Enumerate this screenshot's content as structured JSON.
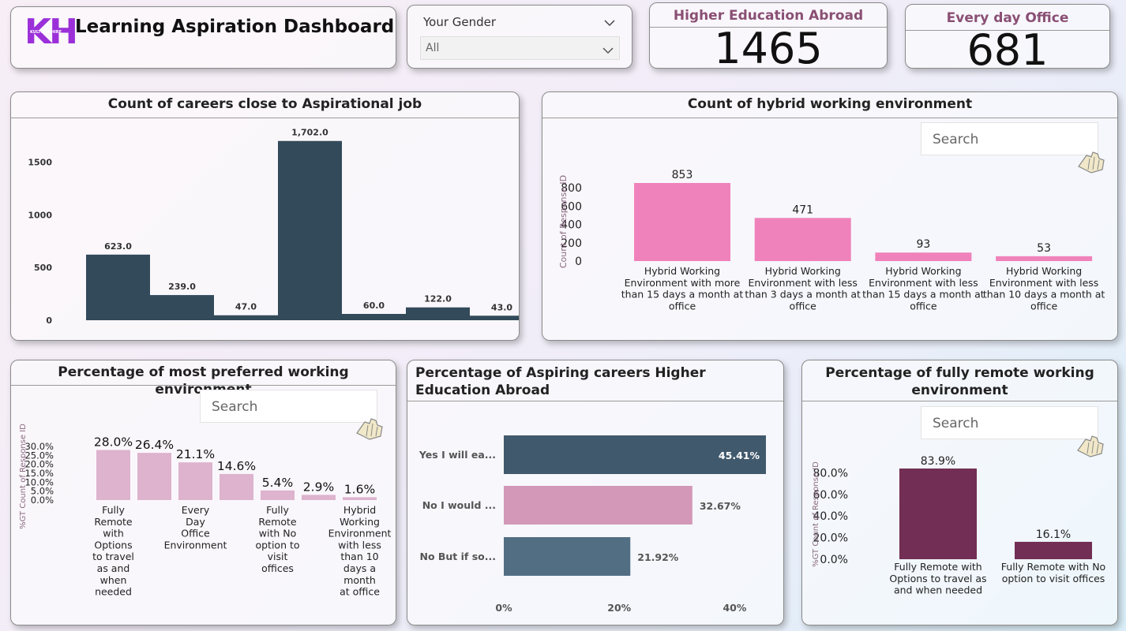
{
  "header": {
    "logo_text": "KH",
    "logo_caption": "KULTURE HIRE",
    "title": "Learning Aspiration Dashboard"
  },
  "filter": {
    "label": "Your Gender",
    "selected": "All"
  },
  "kpis": [
    {
      "label": "Higher Education Abroad",
      "value": "1465"
    },
    {
      "label": "Every day Office",
      "value": "681"
    }
  ],
  "colors": {
    "dark": "#324a5a",
    "pink": "#f082bb",
    "mauve": "#ddb3cd",
    "plum": "#722e55",
    "kpi_label": "#8a4f74",
    "logo": "#9b30d9"
  },
  "search_placeholder": "Search",
  "panels": {
    "careers": "Count of careers close to Aspirational job",
    "hybrid": "Count of hybrid working environment",
    "preferred": "Percentage of most preferred working environment",
    "abroad": "Percentage of Aspiring careers Higher Education Abroad",
    "remote": "Percentage of fully remote working environment"
  },
  "chart_data": [
    {
      "type": "bar",
      "title": "Count of careers close to Aspirational job",
      "values": [
        623.0,
        239.0,
        47.0,
        1702.0,
        60.0,
        122.0,
        43.0
      ],
      "value_labels": [
        "623.0",
        "239.0",
        "47.0",
        "1,702.0",
        "60.0",
        "122.0",
        "43.0"
      ],
      "yticks": [
        0,
        500,
        1000,
        1500
      ],
      "ylim": [
        0,
        1700
      ]
    },
    {
      "type": "bar",
      "title": "Count of hybrid working environment",
      "ylabel": "Count of Response ID",
      "categories": [
        [
          "Hybrid Working",
          "Environment with more",
          "than 15 days a month at",
          "office"
        ],
        [
          "Hybrid Working",
          "Environment with less",
          "than 3 days a month at",
          "office"
        ],
        [
          "Hybrid Working",
          "Environment with less",
          "than 15 days a month at",
          "office"
        ],
        [
          "Hybrid Working",
          "Environment with less",
          "than 10 days a month at",
          "office"
        ]
      ],
      "values": [
        853,
        471,
        93,
        53
      ],
      "yticks": [
        0,
        200,
        400,
        600,
        800
      ],
      "ylim": [
        0,
        853
      ]
    },
    {
      "type": "bar",
      "title": "Percentage of most preferred working environment",
      "ylabel": "%GT Count of Response ID",
      "categories": [
        [
          "Fully",
          "Remote",
          "with",
          "Options",
          "to travel",
          "as and",
          "when",
          "needed"
        ],
        [],
        [
          "Every",
          "Day",
          "Office",
          "Environment"
        ],
        [],
        [
          "Fully",
          "Remote",
          "with No",
          "option to",
          "visit",
          "offices"
        ],
        [],
        [
          "Hybrid",
          "Working",
          "Environment",
          "with less",
          "than 10",
          "days a",
          "month",
          "at office"
        ]
      ],
      "values": [
        28.0,
        26.4,
        21.1,
        14.6,
        5.4,
        2.9,
        1.6
      ],
      "value_labels": [
        "28.0%",
        "26.4%",
        "21.1%",
        "14.6%",
        "5.4%",
        "2.9%",
        "1.6%"
      ],
      "yticks": [
        "0.0%",
        "5.0%",
        "10.0%",
        "15.0%",
        "20.0%",
        "25.0%",
        "30.0%"
      ],
      "ylim": [
        0,
        30
      ]
    },
    {
      "type": "bar",
      "orientation": "horizontal",
      "title": "Percentage of Aspiring careers Higher Education Abroad",
      "categories": [
        "Yes I will ea...",
        "No I would ...",
        "No But if so..."
      ],
      "values": [
        45.41,
        32.67,
        21.92
      ],
      "value_labels": [
        "45.41%",
        "32.67%",
        "21.92%"
      ],
      "xticks": [
        "0%",
        "20%",
        "40%"
      ],
      "xlim": [
        0,
        45.41
      ]
    },
    {
      "type": "bar",
      "title": "Percentage of fully remote working environment",
      "ylabel": "%GT Count of Response ID",
      "categories": [
        [
          "Fully Remote with",
          "Options to travel as",
          "and when needed"
        ],
        [
          "Fully Remote with No",
          "option to visit offices"
        ]
      ],
      "values": [
        83.9,
        16.1
      ],
      "value_labels": [
        "83.9%",
        "16.1%"
      ],
      "yticks": [
        "0.0%",
        "20.0%",
        "40.0%",
        "60.0%",
        "80.0%"
      ],
      "ylim": [
        0,
        83.9
      ]
    }
  ]
}
